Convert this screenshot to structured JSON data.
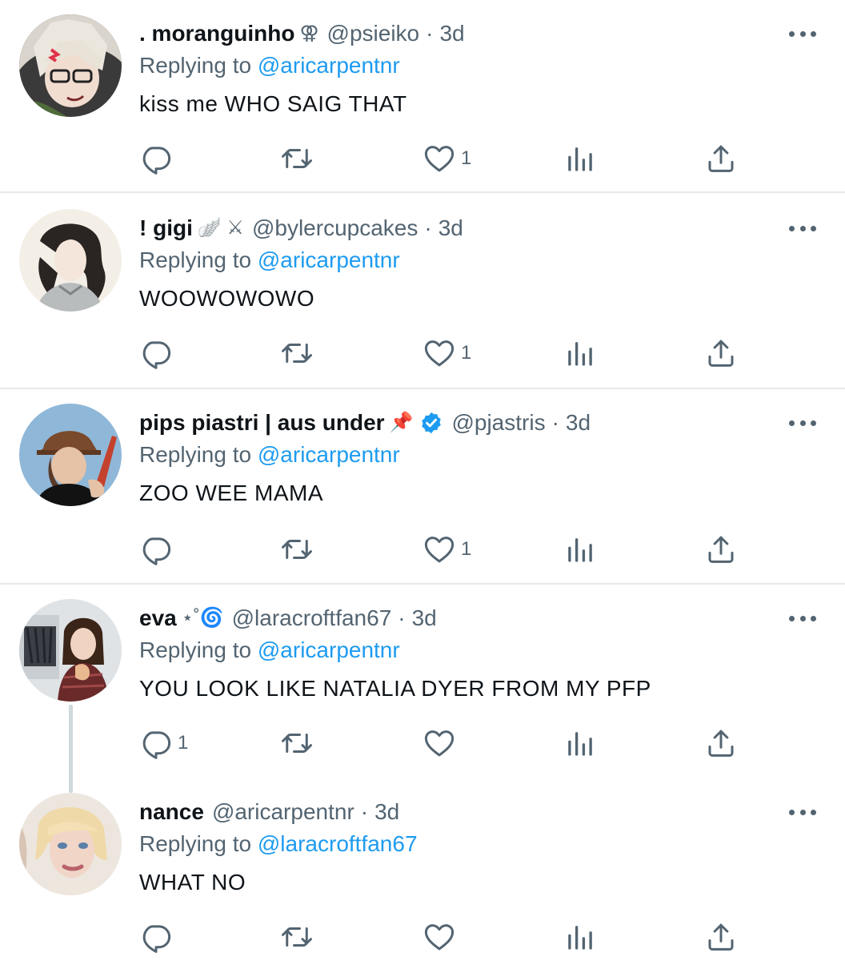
{
  "replying_prefix": "Replying to",
  "dot": "·",
  "tweets": [
    {
      "name": ". moranguinho",
      "emoji": "⚢",
      "handle": "@psieiko",
      "time": "3d",
      "replying_to": "@aricarpentnr",
      "text": "kiss me WHO SAIG THAT",
      "reply_count": "",
      "like_count": "1",
      "avatar": "anime-glasses-avatar"
    },
    {
      "name": "! gigi",
      "emoji": "🪽 ⚔",
      "handle": "@bylercupcakes",
      "time": "3d",
      "replying_to": "@aricarpentnr",
      "text": "WOOWOWOWO",
      "reply_count": "",
      "like_count": "1",
      "avatar": "dark-hair-drawing-avatar"
    },
    {
      "name": "pips piastri | aus under",
      "emoji": "📌",
      "verified": true,
      "handle": "@pjastris",
      "time": "3d",
      "replying_to": "@aricarpentnr",
      "text": "ZOO WEE MAMA",
      "reply_count": "",
      "like_count": "1",
      "avatar": "cap-guitar-avatar"
    },
    {
      "name": "eva",
      "emoji": "⋆˚🌀",
      "handle": "@laracroftfan67",
      "time": "3d",
      "replying_to": "@aricarpentnr",
      "text": "YOU LOOK LIKE NATALIA DYER FROM MY PFP",
      "reply_count": "1",
      "like_count": "",
      "avatar": "photo-woman-avatar"
    },
    {
      "name": "nance",
      "emoji": "",
      "handle": "@aricarpentnr",
      "time": "3d",
      "replying_to": "@laracroftfan67",
      "text": "WHAT NO",
      "reply_count": "",
      "like_count": "",
      "avatar": "blonde-woman-avatar"
    }
  ],
  "colors": {
    "text": "#0f1419",
    "secondary": "#536471",
    "link": "#1d9bf0",
    "divider": "#e6e9ec",
    "verified": "#1d9bf0"
  }
}
